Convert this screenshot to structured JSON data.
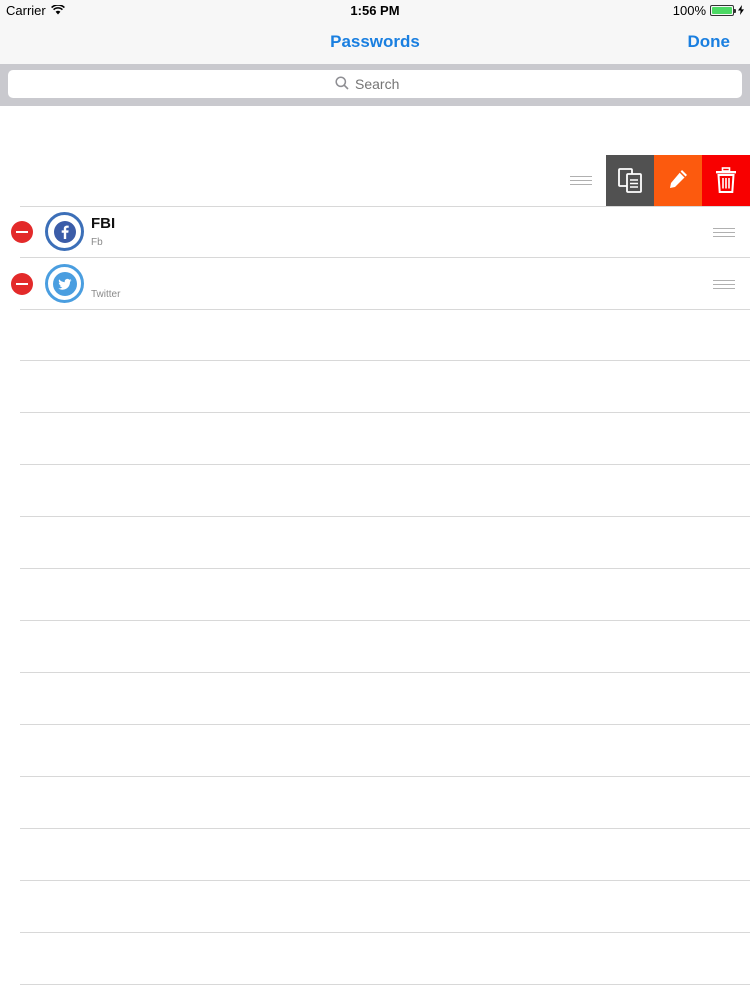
{
  "status_bar": {
    "carrier": "Carrier",
    "time": "1:56 PM",
    "battery": "100%"
  },
  "nav": {
    "title": "Passwords",
    "done_label": "Done"
  },
  "search": {
    "placeholder": "Search"
  },
  "swiped_row": {
    "actions": [
      "copy",
      "edit",
      "delete"
    ]
  },
  "items": [
    {
      "name": "FBI",
      "subtitle": "Fb",
      "icon": "facebook-icon"
    },
    {
      "name": "",
      "subtitle": "Twitter",
      "icon": "twitter-icon"
    }
  ],
  "colors": {
    "accent": "#1a7fe0",
    "copy": "#515151",
    "edit": "#fc5a0e",
    "delete": "#f80000",
    "minus": "#e32a2a"
  }
}
